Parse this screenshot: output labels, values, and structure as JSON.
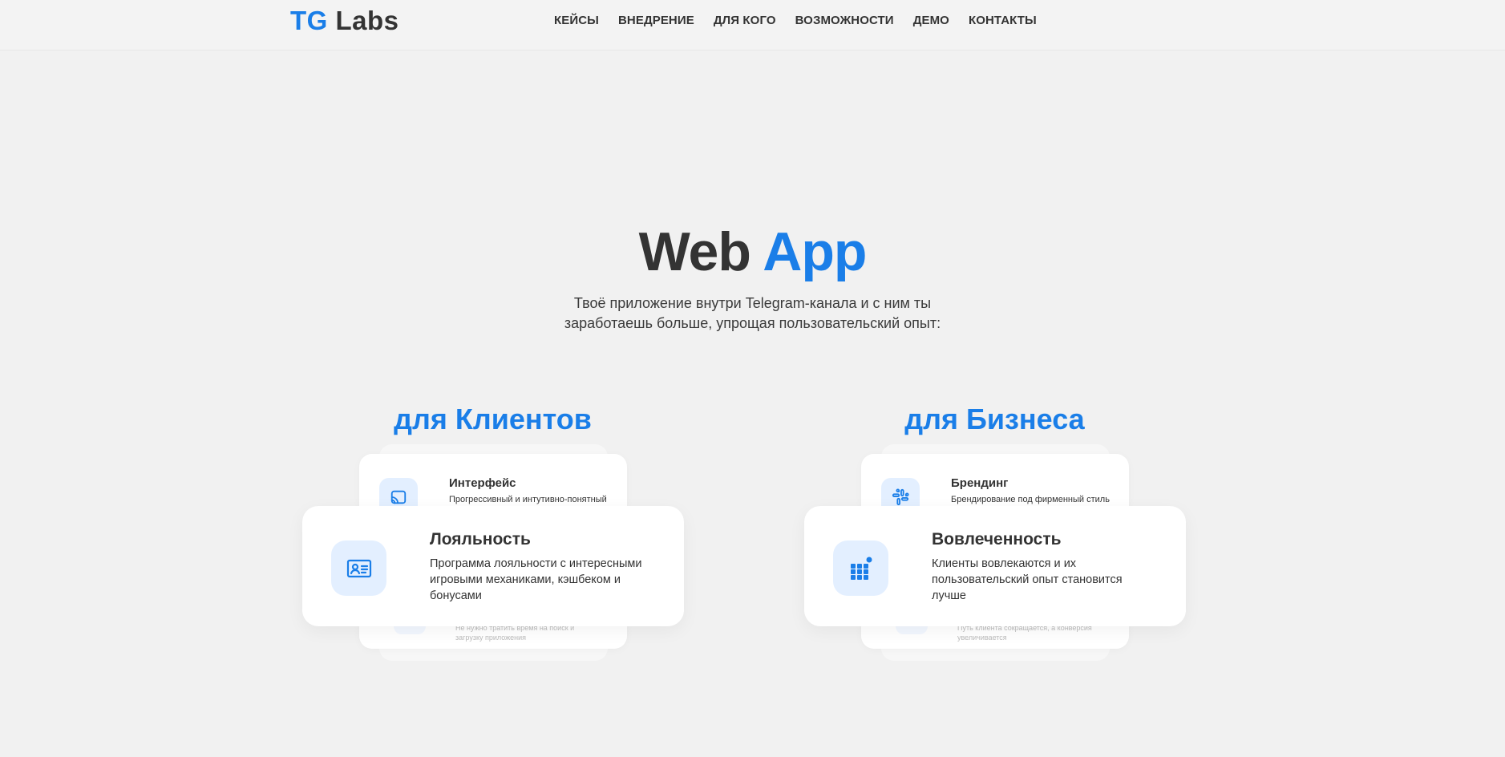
{
  "header": {
    "logo": {
      "tg": "TG",
      "labs": "Labs"
    },
    "nav": [
      "КЕЙСЫ",
      "ВНЕДРЕНИЕ",
      "ДЛЯ КОГО",
      "ВОЗМОЖНОСТИ",
      "ДЕМО",
      "КОНТАКТЫ"
    ]
  },
  "hero": {
    "title_part1": "Web",
    "title_part2": "App",
    "subtitle_line1": "Твоё приложение внутри Telegram-канала и с ним ты",
    "subtitle_line2": "заработаешь больше, упрощая пользовательский опыт:"
  },
  "clients": {
    "title": "для Клиентов",
    "back_card": {
      "title": "Интерфейс",
      "desc": "Прогрессивный и интутивно-понятный",
      "icon": "cast-icon"
    },
    "front_card": {
      "title": "Лояльность",
      "desc_lines": [
        "Программа лояльности с интересными",
        "игровыми механиками, кэшбеком и",
        "бонусами"
      ],
      "icon": "id-card-icon"
    },
    "under_card": {
      "desc_lines": [
        "Не нужно тратить время на поиск и",
        "загрузку приложения"
      ],
      "icon": "download-icon"
    }
  },
  "business": {
    "title": "для Бизнеса",
    "back_card": {
      "title": "Брендинг",
      "desc": "Брендирование под фирменный стиль",
      "icon": "slack-icon"
    },
    "front_card": {
      "title": "Вовлеченность",
      "desc_lines": [
        "Клиенты вовлекаются и их",
        "пользовательский опыт становится",
        "лучше"
      ],
      "icon": "grid-apps-icon"
    },
    "under_card": {
      "desc_lines": [
        "Путь клиента сокращается, а конверсия",
        "увеличивается"
      ],
      "icon": "funnel-icon"
    }
  },
  "colors": {
    "accent": "#1a7ee8",
    "text": "#333333",
    "background": "#f1f1f1",
    "icon_bg": "#e3efff"
  }
}
